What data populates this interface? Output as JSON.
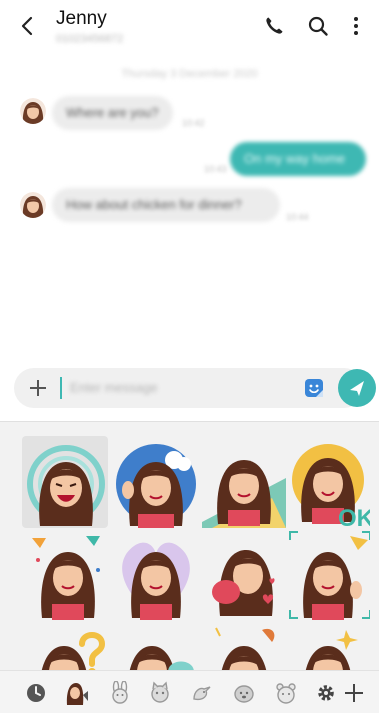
{
  "header": {
    "contact_name": "Jenny",
    "contact_number": "01023456872"
  },
  "chat": {
    "date_label": "Thursday 3 December 2020",
    "messages": [
      {
        "direction": "incoming",
        "text": "Where are you?",
        "time": "10:42"
      },
      {
        "direction": "outgoing",
        "text": "On my way home",
        "time": "10:43"
      },
      {
        "direction": "incoming",
        "text": "How about chicken for dinner?",
        "time": "10:44"
      }
    ]
  },
  "composer": {
    "placeholder": "Enter message"
  },
  "sticker_panel": {
    "stickers": [
      {
        "expression": "laughing"
      },
      {
        "expression": "waving"
      },
      {
        "expression": "thumbs-up"
      },
      {
        "expression": "ok",
        "caption": "OK"
      },
      {
        "expression": "party"
      },
      {
        "expression": "heart"
      },
      {
        "expression": "kiss"
      },
      {
        "expression": "wave"
      },
      {
        "expression": "question"
      },
      {
        "expression": "scared"
      },
      {
        "expression": "sleepy"
      },
      {
        "expression": "wink"
      }
    ],
    "tabs": [
      "recent-icon",
      "my-emoji-icon",
      "bunny-icon",
      "cat-icon",
      "bird-icon",
      "dog-icon",
      "bear-icon",
      "settings-icon",
      "add-icon"
    ]
  },
  "colors": {
    "accent": "#3eb8b3",
    "bubble_incoming": "#ececec",
    "panel_background": "#f2f2f2"
  }
}
